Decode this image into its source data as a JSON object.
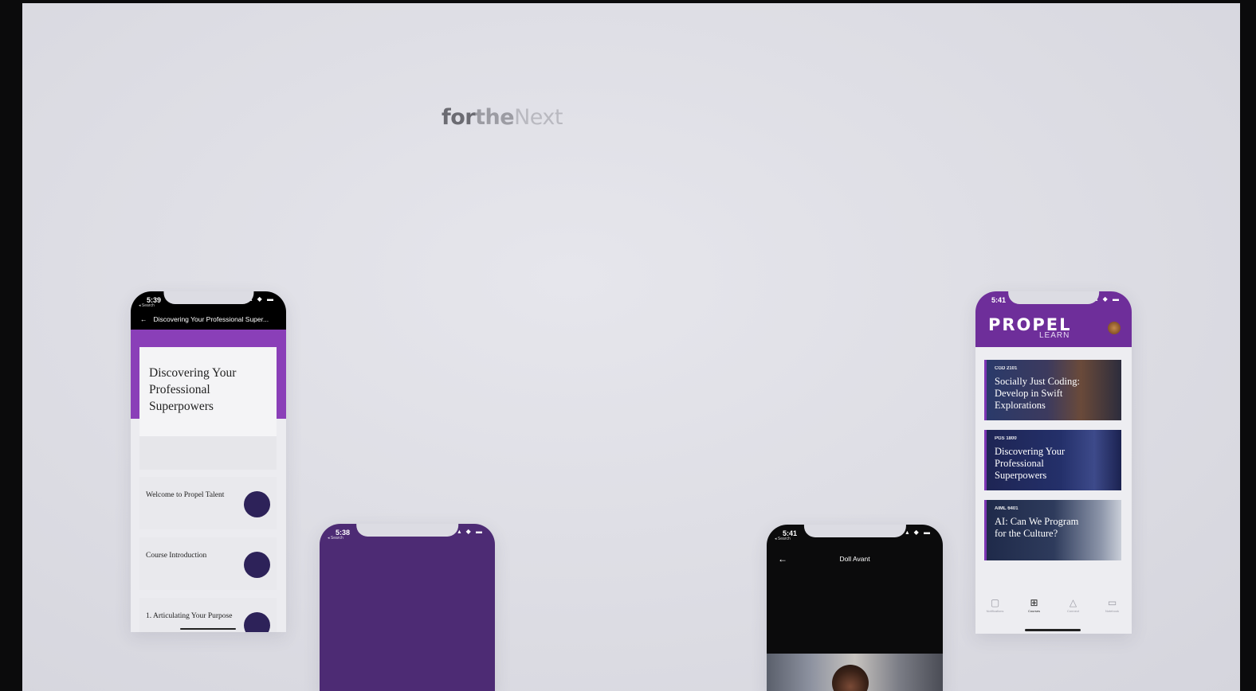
{
  "headline": {
    "word1": "for",
    "word2": "the",
    "word3": "Next"
  },
  "phone1": {
    "time": "5:39",
    "back_label": "◂ Search",
    "status_icons": "▴ ◆ ▬",
    "nav_title": "Discovering Your Professional Super...",
    "course_title": "Discovering Your Professional Superpowers",
    "lessons": [
      {
        "label": "Welcome to Propel Talent"
      },
      {
        "label": "Course Introduction"
      },
      {
        "label": "1. Articulating Your Purpose"
      }
    ]
  },
  "phone2": {
    "time": "5:38",
    "back_label": "◂ Search",
    "status_icons": "▴ ◆ ▬"
  },
  "phone3": {
    "time": "5:41",
    "back_label": "◂ Search",
    "status_icons": "▴ ◆ ▬",
    "nav_title": "Doll Avant"
  },
  "phone4": {
    "time": "5:41",
    "status_icons": "▴ ◆ ▬",
    "logo": "PROPEL",
    "logo_sub": "LEARN",
    "courses": [
      {
        "code": "CGD 2101",
        "title": "Socially Just Coding: Develop in Swift Explorations"
      },
      {
        "code": "PGS 1800",
        "title": "Discovering Your Professional Superpowers"
      },
      {
        "code": "AIML 6401",
        "title": "AI: Can We Program for the Culture?"
      }
    ],
    "tabs": [
      {
        "icon": "calendar-icon",
        "label": "Notifications"
      },
      {
        "icon": "grid-icon",
        "label": "Courses"
      },
      {
        "icon": "network-icon",
        "label": "Connect"
      },
      {
        "icon": "book-icon",
        "label": "Notebook"
      }
    ]
  },
  "colors": {
    "brand_purple": "#6e2e9a",
    "deep_purple": "#4d2b74",
    "dot_navy": "#2d2259"
  }
}
